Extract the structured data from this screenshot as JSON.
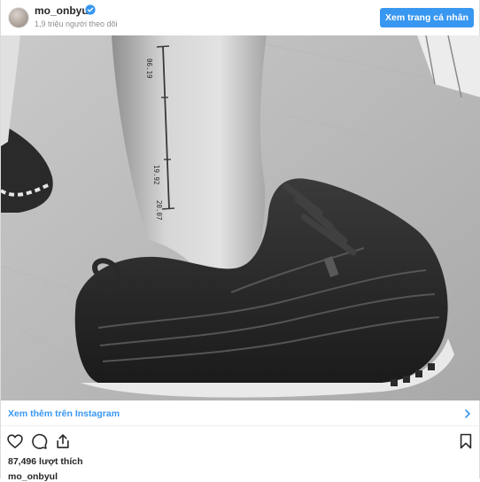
{
  "header": {
    "username": "mo_onbyul",
    "followers": "1,9 triệu người theo dõi",
    "profile_button": "Xem trang cá nhân",
    "verified_icon": "verified-badge-icon"
  },
  "photo": {
    "tattoo_labels": [
      "06.19",
      "19.92",
      "20.07"
    ],
    "alt_content": "ankle tattoo with sneaker"
  },
  "footer": {
    "view_more": "Xem thêm trên Instagram",
    "likes": "87,496 lượt thích",
    "caption_username": "mo_onbyul"
  },
  "icons": {
    "like": "heart-icon",
    "comment": "comment-icon",
    "share": "share-icon",
    "save": "bookmark-icon"
  },
  "colors": {
    "accent": "#3897f0",
    "text": "#262626",
    "muted": "#8e8e8e"
  }
}
